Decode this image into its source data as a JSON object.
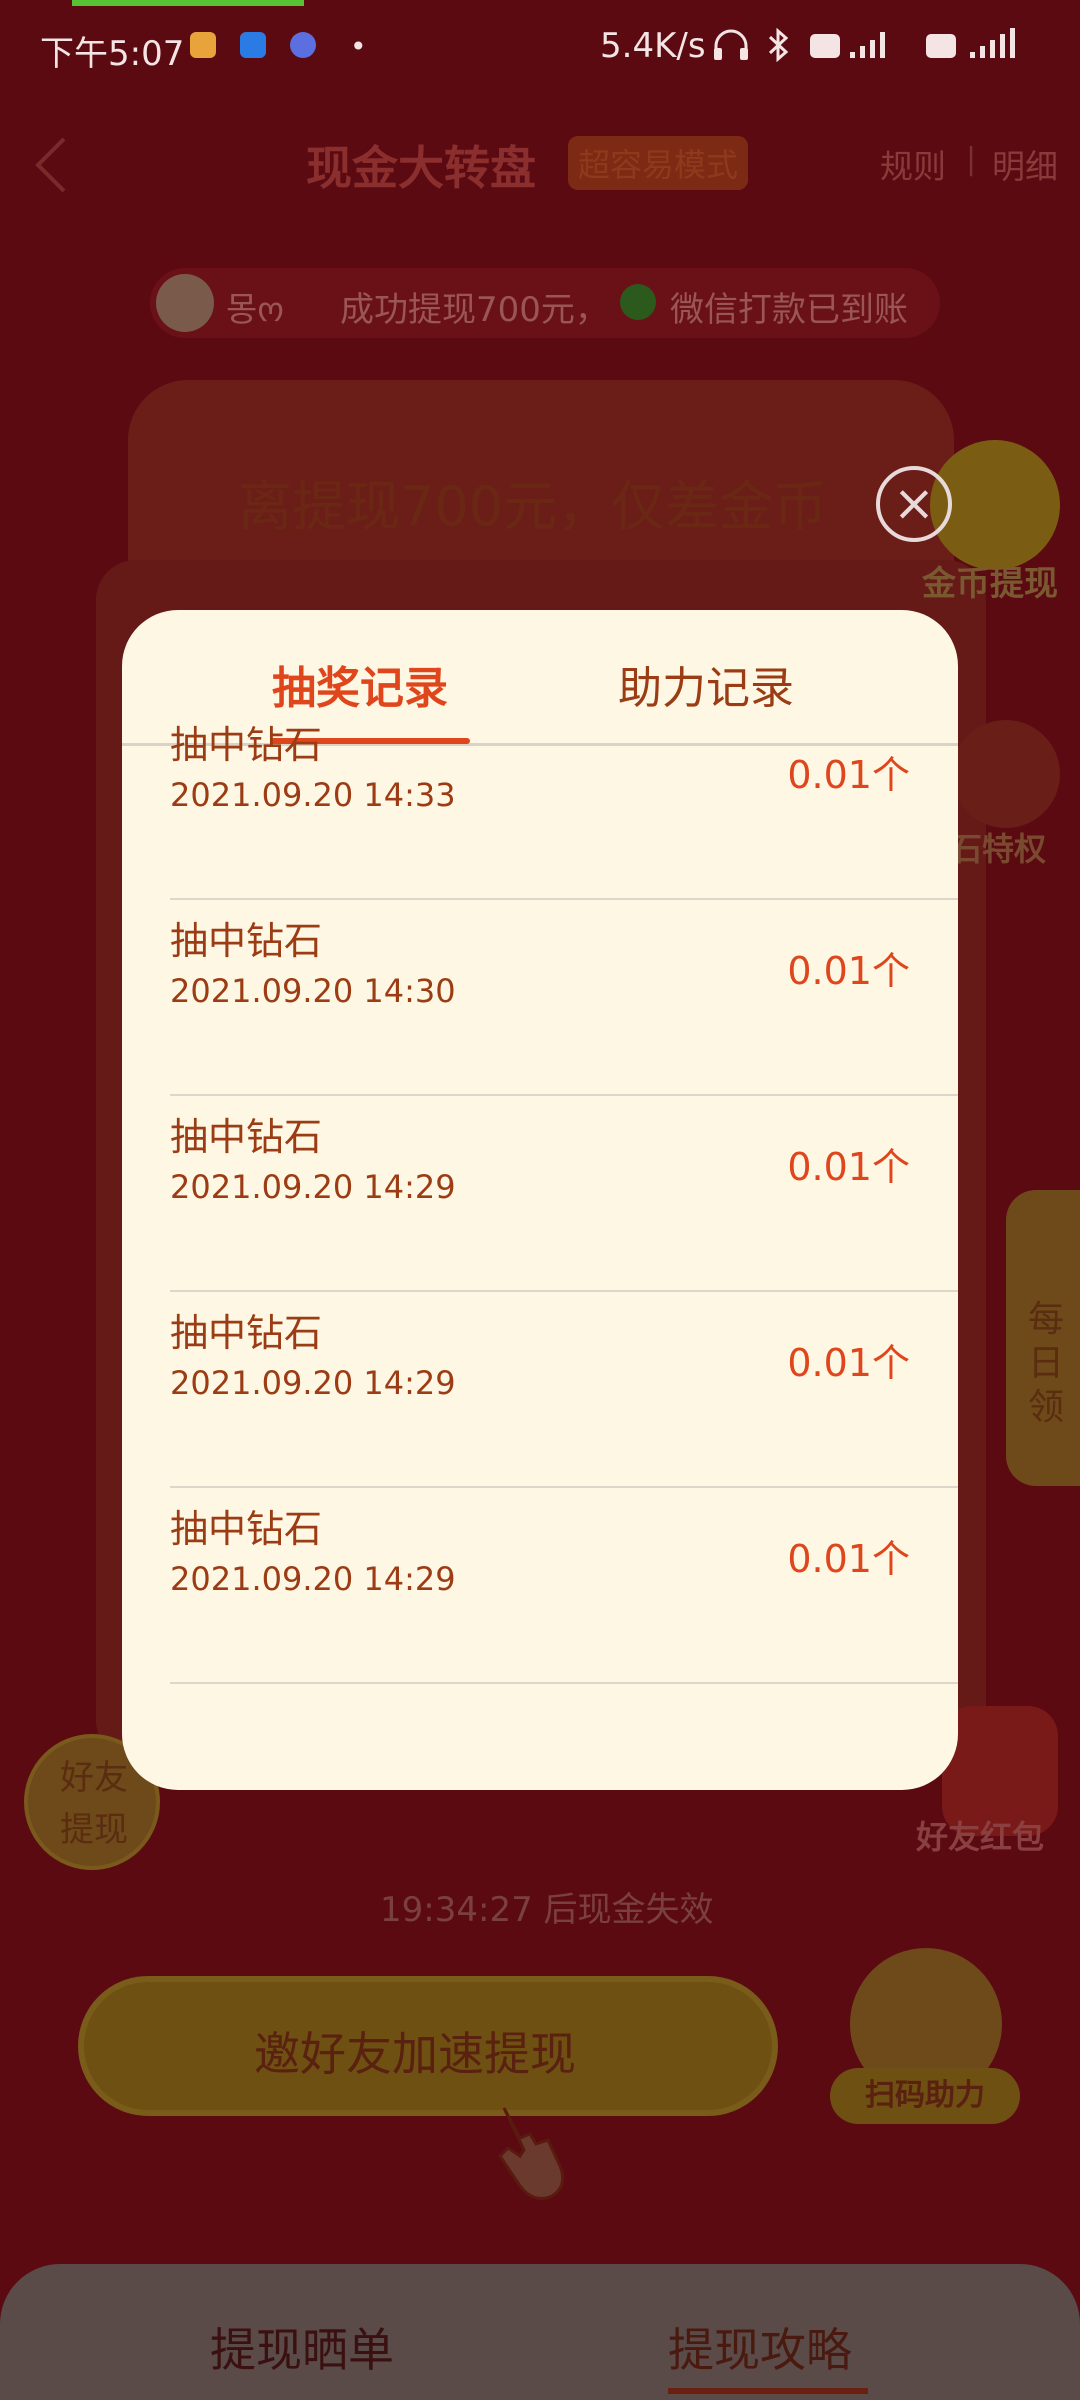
{
  "status_bar": {
    "time": "下午5:07",
    "dot": "•",
    "net_speed": "5.4K/s"
  },
  "header": {
    "title": "现金大转盘",
    "mode_tag": "超容易模式",
    "rules": "规则",
    "separator": "|",
    "detail": "明细"
  },
  "ticker": {
    "user_name": "몽ო",
    "message": "成功提现700元，",
    "message_suffix": "微信打款已到账"
  },
  "main_card": {
    "headline": "离提现700元，仅差金币"
  },
  "side_widgets": {
    "coin_withdraw": "金币提现",
    "diamond_privilege": "石特权",
    "daily": [
      "每",
      "日",
      "领"
    ],
    "friend_withdraw": "好友提现",
    "friend_redpacket": "好友红包",
    "scan_assist": "扫码助力"
  },
  "countdown_text": "19:34:27 后现金失效",
  "invite_button": "邀好友加速提现",
  "bottom_tabs": {
    "left": "提现晒单",
    "right": "提现攻略"
  },
  "modal": {
    "tabs": [
      {
        "label": "抽奖记录",
        "active": true
      },
      {
        "label": "助力记录",
        "active": false
      }
    ],
    "records": [
      {
        "title": "抽中钻石",
        "time": "2021.09.20 14:33",
        "amount": "0.01个"
      },
      {
        "title": "抽中钻石",
        "time": "2021.09.20 14:30",
        "amount": "0.01个"
      },
      {
        "title": "抽中钻石",
        "time": "2021.09.20 14:29",
        "amount": "0.01个"
      },
      {
        "title": "抽中钻石",
        "time": "2021.09.20 14:29",
        "amount": "0.01个"
      },
      {
        "title": "抽中钻石",
        "time": "2021.09.20 14:29",
        "amount": "0.01个"
      }
    ]
  },
  "colors": {
    "overlay_bg": "#5b0a12",
    "modal_bg": "#fdf7e4",
    "accent": "#e0461c",
    "text_brown": "#9c3c14"
  },
  "icons": {
    "back": "back-arrow-icon",
    "close": "close-icon",
    "headset": "headset-icon",
    "bluetooth": "bluetooth-icon",
    "signal": "signal-icon",
    "check": "check-icon",
    "hand": "pointing-hand-icon",
    "scan": "qr-scan-icon"
  }
}
